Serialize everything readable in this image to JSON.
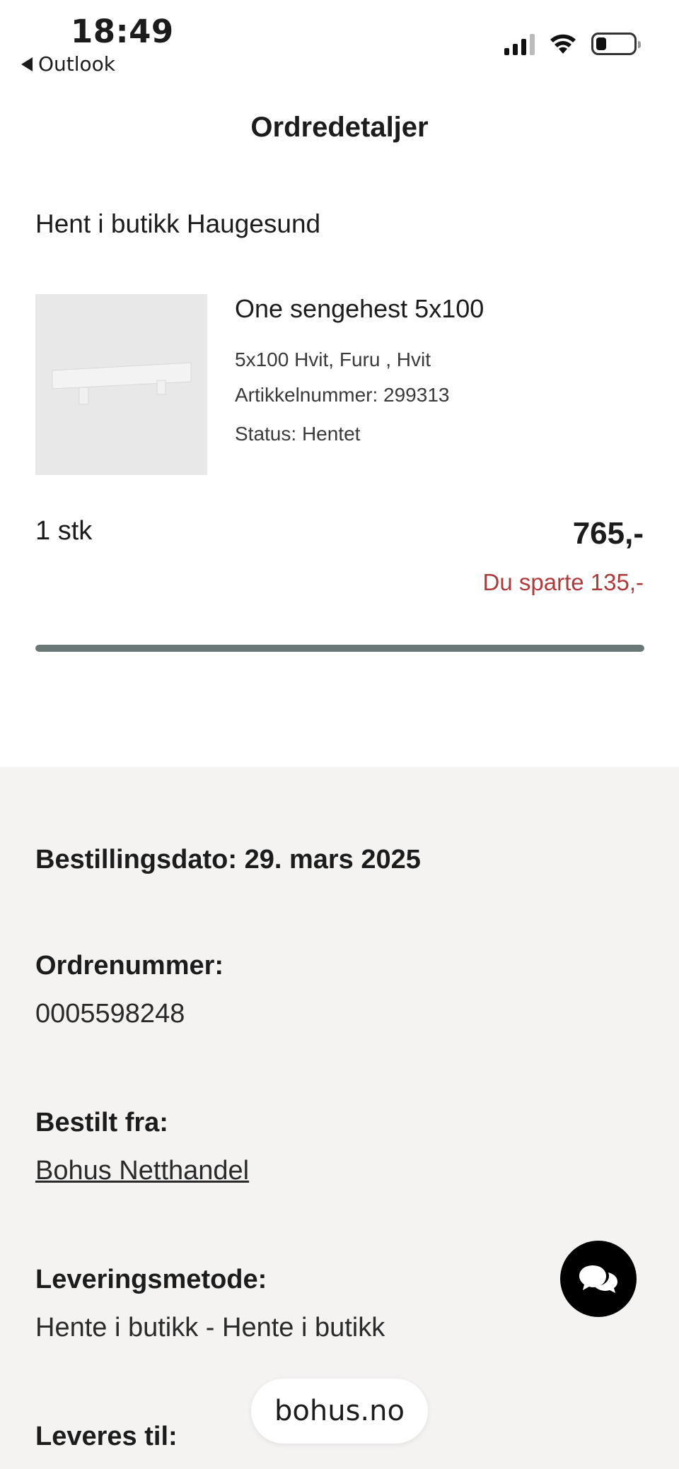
{
  "status_bar": {
    "time": "18:49",
    "back_label": "Outlook",
    "icons": [
      "signal-icon",
      "wifi-icon",
      "battery-icon"
    ]
  },
  "page": {
    "title": "Ordredetaljer"
  },
  "store": {
    "title": "Hent i butikk Haugesund"
  },
  "product": {
    "name": "One sengehest 5x100",
    "variant": "5x100 Hvit, Furu , Hvit",
    "article": "Artikkelnummer: 299313",
    "status": "Status: Hentet",
    "quantity": "1 stk",
    "price": "765,-",
    "saved": "Du sparte 135,-",
    "progress_fraction": 1.0
  },
  "details": {
    "order_date": "Bestillingsdato: 29. mars 2025",
    "order_number_label": "Ordrenummer:",
    "order_number_value": "0005598248",
    "ordered_from_label": "Bestilt fra:",
    "ordered_from_value": "Bohus Netthandel",
    "delivery_method_label": "Leveringsmetode:",
    "delivery_method_value": "Hente i butikk - Hente i butikk",
    "delivered_to_label": "Leveres til:"
  },
  "browser": {
    "url": "bohus.no"
  },
  "colors": {
    "saved_red": "#b03a3a",
    "progress": "#6b7878",
    "details_bg": "#f4f3f2"
  }
}
